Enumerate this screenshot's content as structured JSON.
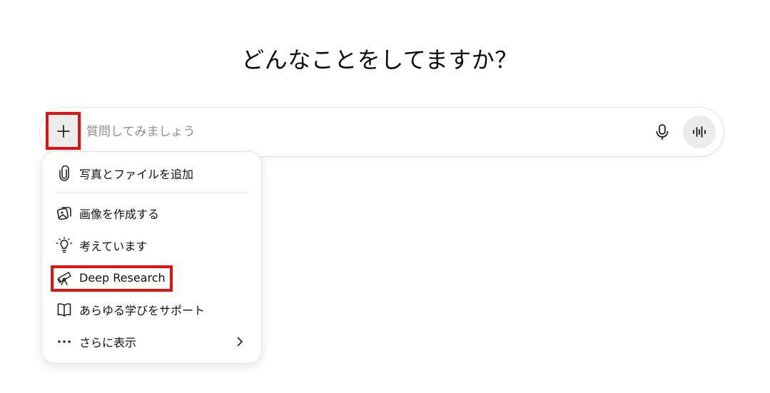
{
  "heading": "どんなことをしてますか？",
  "composer": {
    "placeholder": "質問してみましょう",
    "add_icon": "plus-icon",
    "mic_icon": "microphone-icon",
    "voice_icon": "voice-waveform-icon"
  },
  "menu": {
    "items": [
      {
        "label": "写真とファイルを追加",
        "icon": "paperclip-icon"
      },
      {
        "label": "画像を作成する",
        "icon": "image-create-icon"
      },
      {
        "label": "考えています",
        "icon": "lightbulb-icon"
      },
      {
        "label": "Deep Research",
        "icon": "telescope-icon"
      },
      {
        "label": "あらゆる学びをサポート",
        "icon": "open-book-icon"
      },
      {
        "label": "さらに表示",
        "icon": "more-dots-icon",
        "trailing_icon": "chevron-right-icon"
      }
    ]
  },
  "annotations": {
    "highlight_color": "#e31010"
  }
}
